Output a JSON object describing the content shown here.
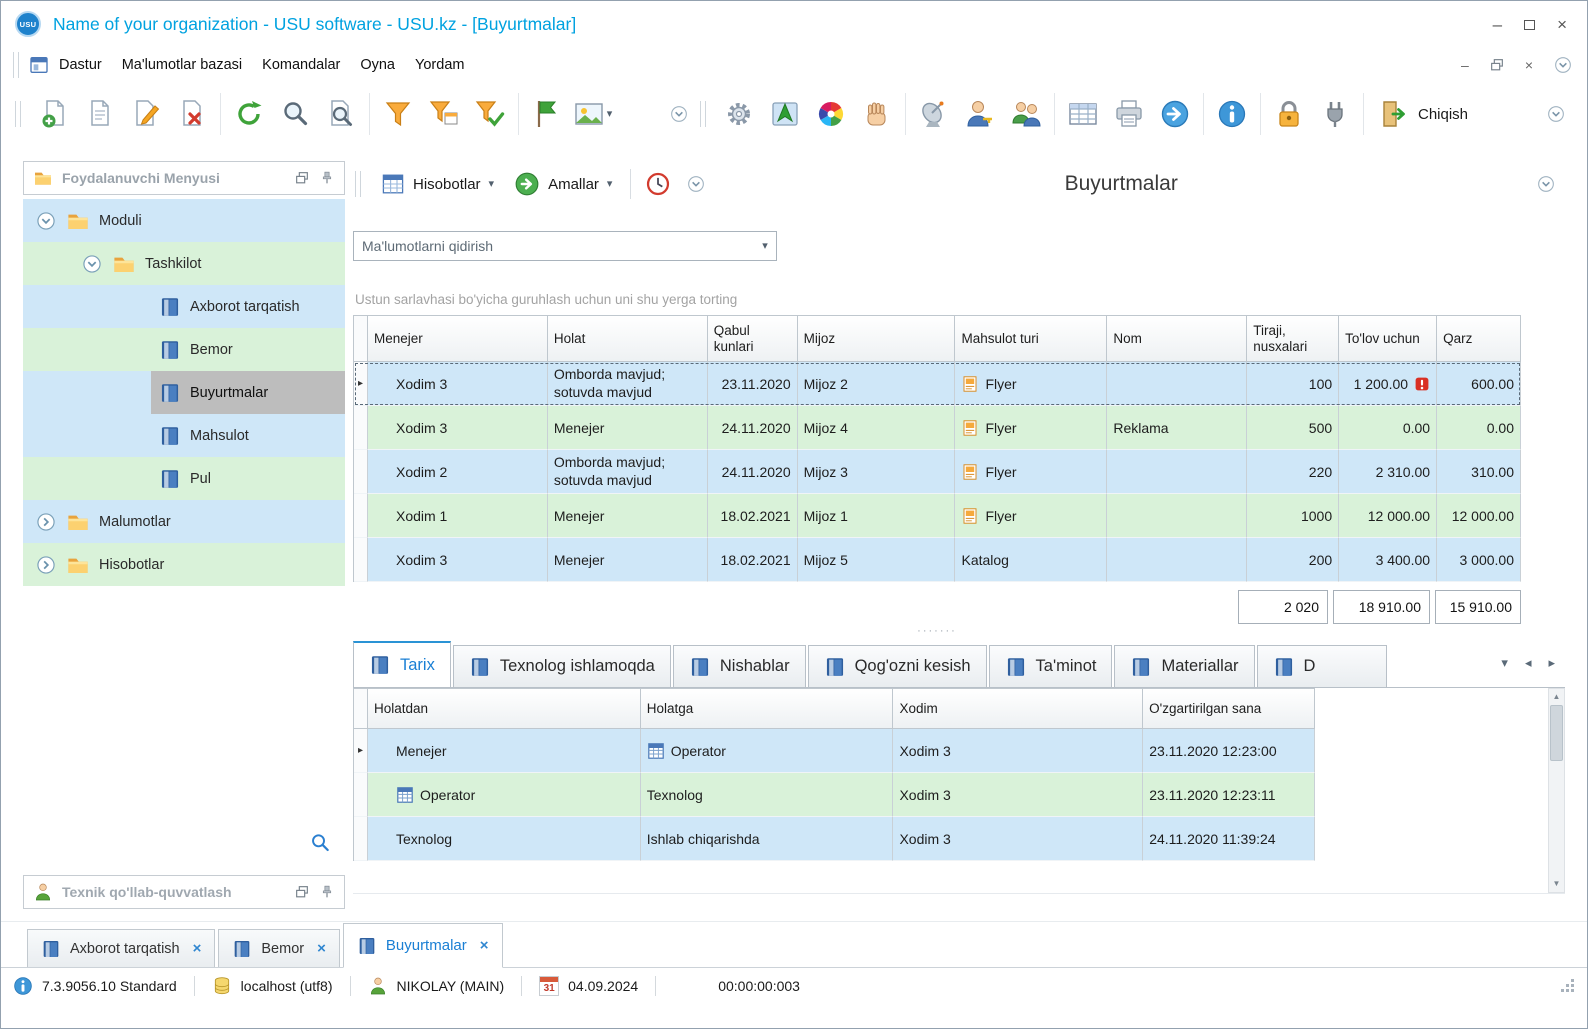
{
  "window": {
    "title": "Name of your organization - USU software - USU.kz - [Buyurtmalar]",
    "logo": "USU"
  },
  "menubar": {
    "items": [
      "Dastur",
      "Ma'lumotlar bazasi",
      "Komandalar",
      "Oyna",
      "Yordam"
    ]
  },
  "toolbar": {
    "exit_label": "Chiqish"
  },
  "sidebar": {
    "header": "Foydalanuvchi Menyusi",
    "support_header": "Texnik qo'llab-quvvatlash",
    "tree": {
      "moduli": "Moduli",
      "tashkilot": "Tashkilot",
      "axborot": "Axborot tarqatish",
      "bemor": "Bemor",
      "buyurtmalar": "Buyurtmalar",
      "mahsulot": "Mahsulot",
      "pul": "Pul",
      "malumotlar": "Malumotlar",
      "hisobotlar": "Hisobotlar"
    }
  },
  "main": {
    "reports_button": "Hisobotlar",
    "actions_button": "Amallar",
    "page_title": "Buyurtmalar",
    "search_placeholder": "Ma'lumotlarni qidirish",
    "group_hint": "Ustun sarlavhasi bo'yicha guruhlash uchun uni shu yerga torting",
    "grid": {
      "columns": {
        "menejer": "Menejer",
        "holat": "Holat",
        "qabul": "Qabul kunlari",
        "mijoz": "Mijoz",
        "mahsulot": "Mahsulot turi",
        "nom": "Nom",
        "tiraji": "Tiraji, nusxalari",
        "tolov": "To'lov uchun",
        "qarz": "Qarz"
      },
      "rows": [
        {
          "menejer": "Xodim 3",
          "holat": "Omborda mavjud; sotuvda mavjud",
          "qabul": "23.11.2020",
          "mijoz": "Mijoz 2",
          "mahsulot": "Flyer",
          "nom": "",
          "tiraji": "100",
          "tolov": "1 200.00",
          "qarz": "600.00"
        },
        {
          "menejer": "Xodim 3",
          "holat": "Menejer",
          "qabul": "24.11.2020",
          "mijoz": "Mijoz 4",
          "mahsulot": "Flyer",
          "nom": "Reklama",
          "tiraji": "500",
          "tolov": "0.00",
          "qarz": "0.00"
        },
        {
          "menejer": "Xodim 2",
          "holat": "Omborda mavjud; sotuvda mavjud",
          "qabul": "24.11.2020",
          "mijoz": "Mijoz 3",
          "mahsulot": "Flyer",
          "nom": "",
          "tiraji": "220",
          "tolov": "2 310.00",
          "qarz": "310.00"
        },
        {
          "menejer": "Xodim 1",
          "holat": "Menejer",
          "qabul": "18.02.2021",
          "mijoz": "Mijoz 1",
          "mahsulot": "Flyer",
          "nom": "",
          "tiraji": "1000",
          "tolov": "12 000.00",
          "qarz": "12 000.00"
        },
        {
          "menejer": "Xodim 3",
          "holat": "Menejer",
          "qabul": "18.02.2021",
          "mijoz": "Mijoz 5",
          "mahsulot": "Katalog",
          "nom": "",
          "tiraji": "200",
          "tolov": "3 400.00",
          "qarz": "3 000.00"
        }
      ],
      "summary": {
        "tiraji": "2 020",
        "tolov": "18 910.00",
        "qarz": "15 910.00"
      }
    },
    "detail_tabs": {
      "tarix": "Tarix",
      "texnolog": "Texnolog ishlamoqda",
      "nishablar": "Nishablar",
      "qogozni": "Qog'ozni kesish",
      "taminot": "Ta'minot",
      "materiallar": "Materiallar",
      "cut": "D"
    },
    "history": {
      "columns": {
        "holatdan": "Holatdan",
        "holatga": "Holatga",
        "xodim": "Xodim",
        "sana": "O'zgartirilgan sana"
      },
      "rows": [
        {
          "holatdan": "Menejer",
          "holatga": "Operator",
          "xodim": "Xodim 3",
          "sana": "23.11.2020 12:23:00"
        },
        {
          "holatdan": "Operator",
          "holatga": "Texnolog",
          "xodim": "Xodim 3",
          "sana": "23.11.2020 12:23:11"
        },
        {
          "holatdan": "Texnolog",
          "holatga": "Ishlab chiqarishda",
          "xodim": "Xodim 3",
          "sana": "24.11.2020 11:39:24"
        }
      ]
    }
  },
  "document_tabs": {
    "tab1": "Axborot tarqatish",
    "tab2": "Bemor",
    "tab3": "Buyurtmalar"
  },
  "statusbar": {
    "version": "7.3.9056.10 Standard",
    "database": "localhost (utf8)",
    "user": "NIKOLAY (MAIN)",
    "calendar_day": "31",
    "date": "04.09.2024",
    "timer": "00:00:00:003"
  },
  "glyphs": {
    "minimize": "–",
    "close": "×",
    "caret_down": "▾",
    "scroll_left": "◂",
    "scroll_right": "▸",
    "scroll_up": "▲",
    "scroll_down": "▼",
    "row_marker": "▸",
    "dots": "·······"
  },
  "colors": {
    "accent_blue": "#00a2e0",
    "tab_active_blue": "#1a7fd4",
    "row_blue": "#cfe7f8",
    "row_green": "#d9f2d9",
    "selected_gray": "#bdbdbd",
    "warning_red": "#d93025",
    "filter_orange": "#f9ab3c"
  },
  "icons": {
    "new-record-icon": "document with green plus",
    "copy-record-icon": "document",
    "edit-record-icon": "document with pencil",
    "delete-record-icon": "document with red cross",
    "refresh-icon": "green circular arrow",
    "search-icon": "magnifier",
    "search-document-icon": "document with magnifier",
    "filter-icon": "orange funnel",
    "filter-window-icon": "funnel with window",
    "filter-apply-icon": "funnel with green check",
    "flag-icon": "green flag",
    "image-icon": "picture",
    "settings-icon": "gear",
    "map-icon": "map with green arrow",
    "colors-icon": "color wheel",
    "hand-icon": "hand",
    "feed-icon": "satellite dish",
    "user-permissions-icon": "person with key",
    "users-icon": "two persons",
    "table-icon": "data table",
    "print-icon": "printer",
    "forward-icon": "blue circle arrow",
    "info-icon": "blue circle i",
    "lock-icon": "orange padlock",
    "plugin-icon": "plug",
    "exit-icon": "door with green arrow",
    "collapse-icon": "chevron in circle",
    "clock-icon": "clock with red rim",
    "actions-icon": "green circle arrow",
    "reports-icon": "blue table",
    "book-icon": "blue module book",
    "folder-icon": "yellow folder",
    "pin-icon": "thumbtack",
    "float-icon": "overlapping windows",
    "database-icon": "yellow cylinder",
    "calendar-icon": "calendar page 31",
    "flyer-icon": "orange flyer page",
    "warning-icon": "red square exclamation",
    "operator-icon": "small blue grid"
  }
}
